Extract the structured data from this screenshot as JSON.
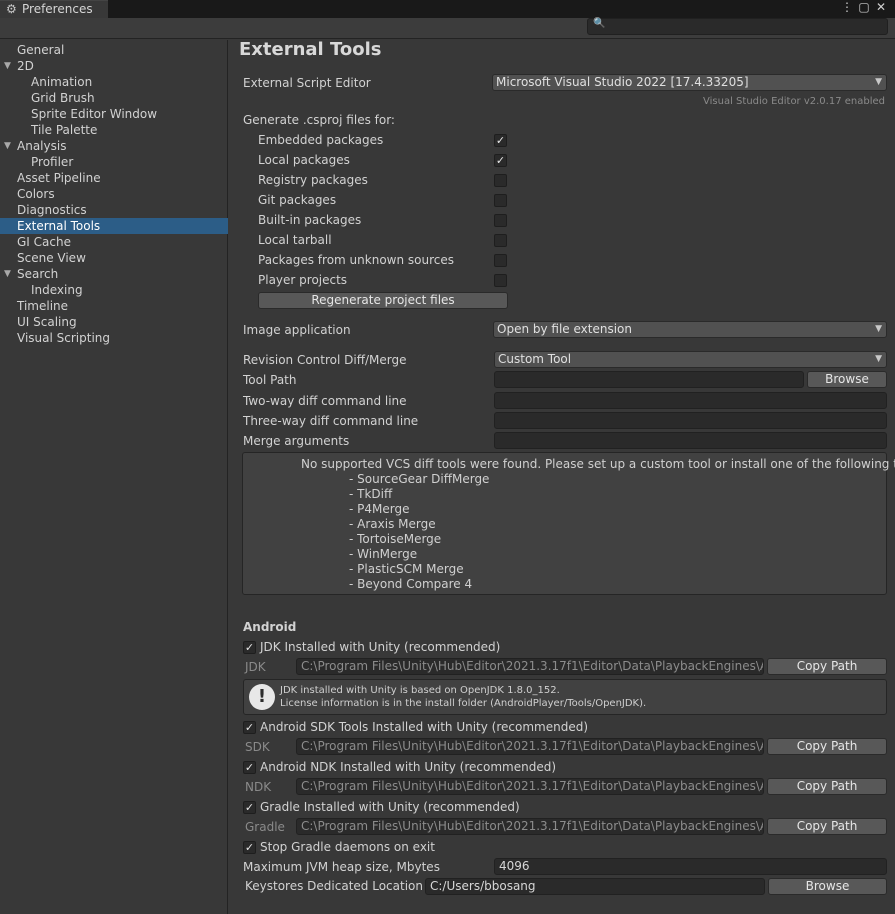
{
  "window": {
    "tab_title": "Preferences",
    "menu_glyph": "⋮",
    "maximize_glyph": "▢",
    "close_glyph": "✕"
  },
  "sidebar": {
    "items": [
      {
        "label": "General",
        "indent": 0
      },
      {
        "label": "2D",
        "indent": 0,
        "expanded": true
      },
      {
        "label": "Animation",
        "indent": 1
      },
      {
        "label": "Grid Brush",
        "indent": 1
      },
      {
        "label": "Sprite Editor Window",
        "indent": 1
      },
      {
        "label": "Tile Palette",
        "indent": 1
      },
      {
        "label": "Analysis",
        "indent": 0,
        "expanded": true
      },
      {
        "label": "Profiler",
        "indent": 1
      },
      {
        "label": "Asset Pipeline",
        "indent": 0
      },
      {
        "label": "Colors",
        "indent": 0
      },
      {
        "label": "Diagnostics",
        "indent": 0
      },
      {
        "label": "External Tools",
        "indent": 0,
        "selected": true
      },
      {
        "label": "GI Cache",
        "indent": 0
      },
      {
        "label": "Scene View",
        "indent": 0
      },
      {
        "label": "Search",
        "indent": 0,
        "expanded": true
      },
      {
        "label": "Indexing",
        "indent": 1
      },
      {
        "label": "Timeline",
        "indent": 0
      },
      {
        "label": "UI Scaling",
        "indent": 0
      },
      {
        "label": "Visual Scripting",
        "indent": 0
      }
    ]
  },
  "main": {
    "title": "External Tools",
    "script_editor": {
      "label": "External Script Editor",
      "value": "Microsoft Visual Studio 2022 [17.4.33205]",
      "note": "Visual Studio Editor v2.0.17 enabled"
    },
    "csproj": {
      "heading": "Generate .csproj files for:",
      "items": [
        {
          "label": "Embedded packages",
          "checked": true
        },
        {
          "label": "Local packages",
          "checked": true
        },
        {
          "label": "Registry packages",
          "checked": false
        },
        {
          "label": "Git packages",
          "checked": false
        },
        {
          "label": "Built-in packages",
          "checked": false
        },
        {
          "label": "Local tarball",
          "checked": false
        },
        {
          "label": "Packages from unknown sources",
          "checked": false
        },
        {
          "label": "Player projects",
          "checked": false
        }
      ],
      "regenerate_label": "Regenerate project files"
    },
    "image_app": {
      "label": "Image application",
      "value": "Open by file extension"
    },
    "revision": {
      "label": "Revision Control Diff/Merge",
      "value": "Custom Tool",
      "tool_path_label": "Tool Path",
      "tool_path_value": "",
      "browse_label": "Browse",
      "two_way_label": "Two-way diff command line",
      "two_way_value": "",
      "three_way_label": "Three-way diff command line",
      "three_way_value": "",
      "merge_label": "Merge arguments",
      "merge_value": "",
      "help_lines": [
        "No supported VCS diff tools were found. Please set up a custom tool or install one of the following tools:",
        "- SourceGear DiffMerge",
        "- TkDiff",
        "- P4Merge",
        "- Araxis Merge",
        "- TortoiseMerge",
        "- WinMerge",
        "- PlasticSCM Merge",
        "- Beyond Compare 4"
      ]
    },
    "android": {
      "heading": "Android",
      "jdk_toggle": "JDK Installed with Unity (recommended)",
      "jdk_label": "JDK",
      "jdk_path": "C:\\Program Files\\Unity\\Hub\\Editor\\2021.3.17f1\\Editor\\Data\\PlaybackEngines\\AndroidPlayer\\OpenJDK",
      "copy_path": "Copy Path",
      "jdk_info_1": "JDK installed with Unity is based on OpenJDK 1.8.0_152.",
      "jdk_info_2": "License information is in the install folder (AndroidPlayer/Tools/OpenJDK).",
      "sdk_toggle": "Android SDK Tools Installed with Unity (recommended)",
      "sdk_label": "SDK",
      "sdk_path": "C:\\Program Files\\Unity\\Hub\\Editor\\2021.3.17f1\\Editor\\Data\\PlaybackEngines\\AndroidPlayer\\SDK",
      "ndk_toggle": "Android NDK Installed with Unity (recommended)",
      "ndk_label": "NDK",
      "ndk_path": "C:\\Program Files\\Unity\\Hub\\Editor\\2021.3.17f1\\Editor\\Data\\PlaybackEngines\\AndroidPlayer\\NDK",
      "gradle_toggle": "Gradle Installed with Unity (recommended)",
      "gradle_label": "Gradle",
      "gradle_path": "C:\\Program Files\\Unity\\Hub\\Editor\\2021.3.17f1\\Editor\\Data\\PlaybackEngines\\AndroidPlayer\\Tools\\gradle",
      "stop_gradle": "Stop Gradle daemons on exit",
      "jvm_label": "Maximum JVM heap size, Mbytes",
      "jvm_value": "4096",
      "keystore_label": "Keystores Dedicated Location",
      "keystore_value": "C:/Users/bbosang",
      "keystore_browse": "Browse"
    }
  }
}
